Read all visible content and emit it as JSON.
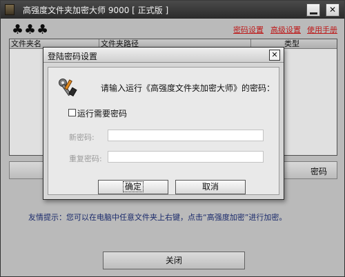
{
  "window": {
    "title": "高强度文件夹加密大师 9000 [ 正式版 ]",
    "minimize_glyph": "",
    "close_glyph": "✕"
  },
  "header": {
    "clubs": "♣♣♣",
    "links": [
      "密码设置",
      "高级设置",
      "使用手册"
    ]
  },
  "list": {
    "columns": [
      "文件夹名",
      "文件夹路径",
      "类型"
    ]
  },
  "action_button": {
    "label": "密码"
  },
  "tip": "友情提示：您可以在电脑中任意文件夹上右键，点击“高强度加密”进行加密。",
  "close_button": {
    "label": "关闭"
  },
  "dialog": {
    "title": "登陆密码设置",
    "close_glyph": "✕",
    "prompt": "请输入运行《高强度文件夹加密大师》的密码：",
    "checkbox_label": "运行需要密码",
    "checkbox_checked": false,
    "fields": [
      {
        "label": "新密码:",
        "value": ""
      },
      {
        "label": "重复密码:",
        "value": ""
      }
    ],
    "ok_label": "确定",
    "cancel_label": "取消"
  },
  "colors": {
    "link_red": "#d81e1e",
    "tip_blue": "#1d2f7a",
    "titlebar_dark": "#2b2b2b"
  }
}
